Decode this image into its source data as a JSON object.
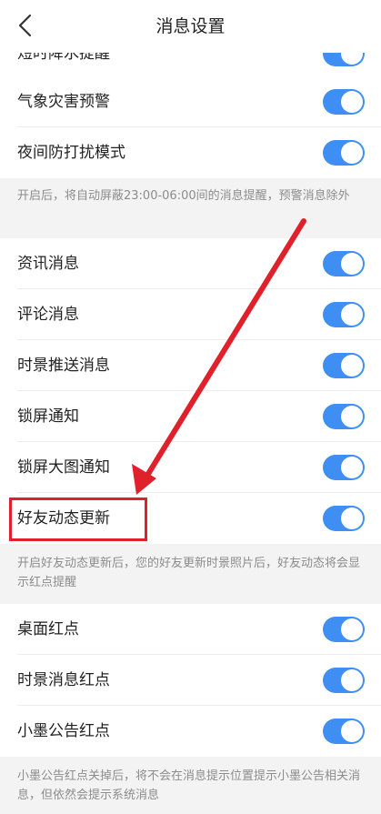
{
  "header": {
    "title": "消息设置",
    "back_icon": "chevron-left-icon"
  },
  "rows_top": [
    {
      "label": "短时降水提醒",
      "on": true
    },
    {
      "label": "气象灾害预警",
      "on": true
    },
    {
      "label": "夜间防打扰模式",
      "on": true
    }
  ],
  "note1": "开启后，将自动屏蔽23:00-06:00间的消息提醒，预警消息除外",
  "rows_mid": [
    {
      "label": "资讯消息",
      "on": true
    },
    {
      "label": "评论消息",
      "on": true
    },
    {
      "label": "时景推送消息",
      "on": true
    },
    {
      "label": "锁屏通知",
      "on": true
    },
    {
      "label": "锁屏大图通知",
      "on": true
    },
    {
      "label": "好友动态更新",
      "on": true
    }
  ],
  "note2": "开启好友动态更新后，您的好友更新时景照片后，好友动态将会显示红点提醒",
  "rows_bottom": [
    {
      "label": "桌面红点",
      "on": true
    },
    {
      "label": "时景消息红点",
      "on": true
    },
    {
      "label": "小墨公告红点",
      "on": true
    }
  ],
  "note3": "小墨公告红点关掉后，将不会在消息提示位置提示小墨公告相关消息，但依然会提示系统消息",
  "colors": {
    "toggle_on": "#3e8ef4",
    "annotation_red": "#e0202b",
    "note_bg": "#f3f3f3"
  }
}
